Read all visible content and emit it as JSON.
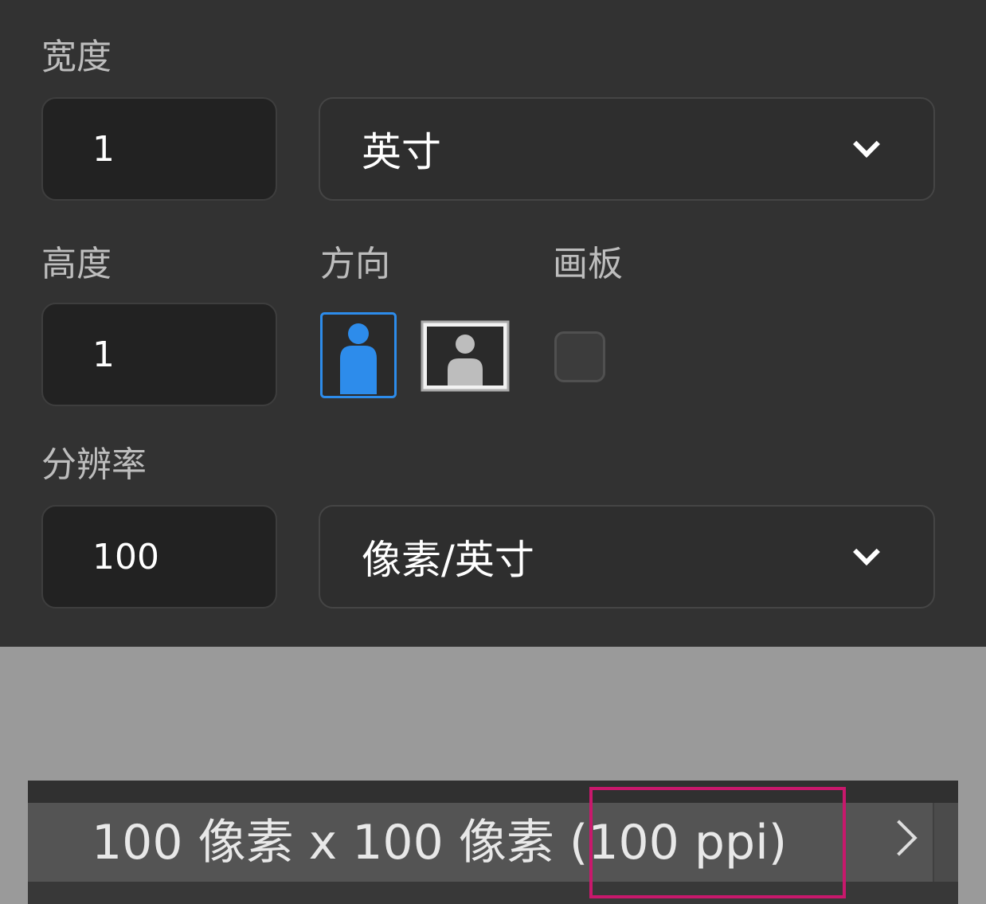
{
  "width": {
    "label": "宽度",
    "value": "1",
    "unit": "英寸"
  },
  "height": {
    "label": "高度",
    "value": "1"
  },
  "orientation": {
    "label": "方向",
    "selected": "portrait",
    "options": [
      "portrait",
      "landscape"
    ]
  },
  "artboard": {
    "label": "画板",
    "checked": false
  },
  "resolution": {
    "label": "分辨率",
    "value": "100",
    "unit": "像素/英寸"
  },
  "status": {
    "text": "100 像素 x 100 像素 (100 ppi)"
  },
  "colors": {
    "panel_bg": "#323232",
    "accent": "#2d8ceb",
    "highlight": "#c8186c"
  },
  "icons": [
    "chevron-down-icon",
    "portrait-person-icon",
    "landscape-person-icon",
    "chevron-right-icon"
  ]
}
